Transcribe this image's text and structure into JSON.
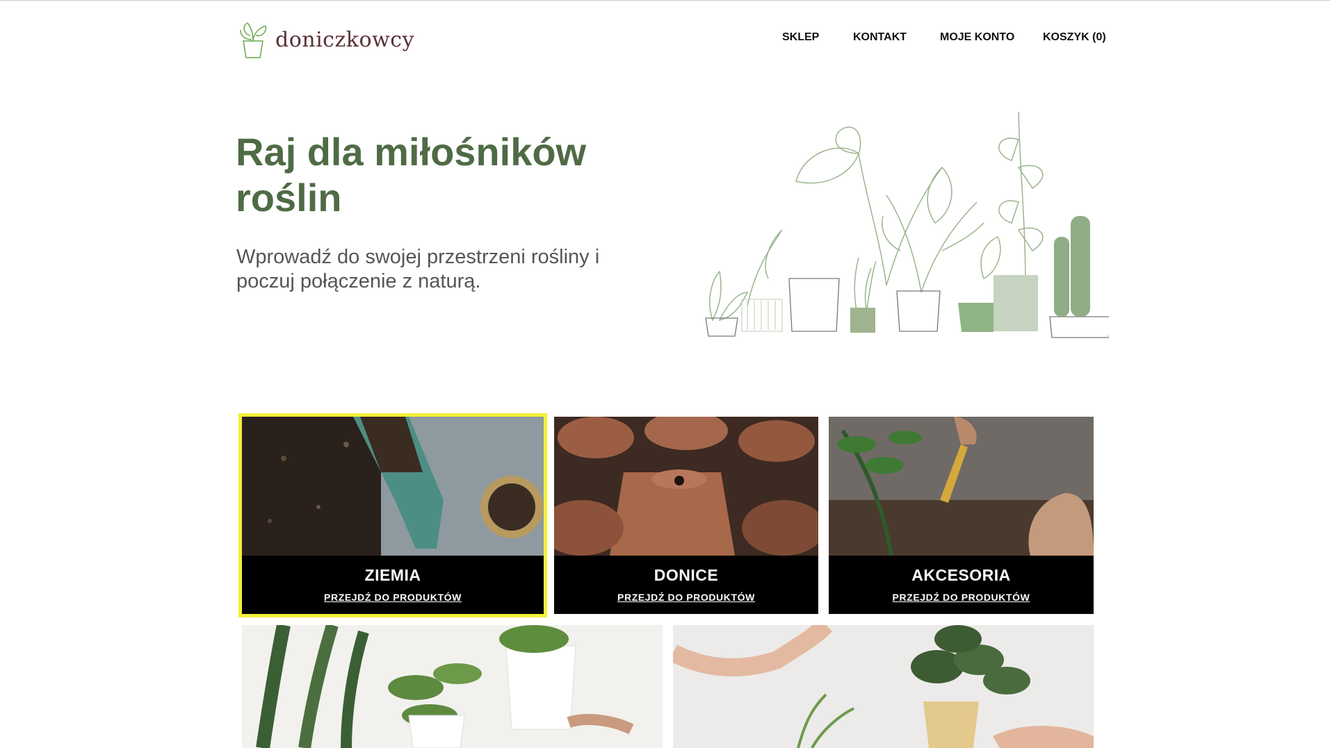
{
  "brand": {
    "name": "doniczkowcy"
  },
  "nav": {
    "shop": "SKLEP",
    "contact": "KONTAKT",
    "account": "MOJE KONTO",
    "cart": "KOSZYK (0)"
  },
  "hero": {
    "title_line1": "Raj dla miłośników",
    "title_line2": "roślin",
    "subtitle_line1": "Wprowadź do swojej przestrzeni rośliny i",
    "subtitle_line2": "poczuj połączenie z naturą."
  },
  "categories": [
    {
      "title": "ZIEMIA",
      "link": "PRZEJDŹ DO PRODUKTÓW"
    },
    {
      "title": "DONICE",
      "link": "PRZEJDŹ DO PRODUKTÓW"
    },
    {
      "title": "AKCESORIA",
      "link": "PRZEJDŹ DO PRODUKTÓW"
    }
  ],
  "colors": {
    "accent_green": "#4f6b45",
    "logo_text": "#5a3036",
    "highlight": "#f4ee3a"
  }
}
